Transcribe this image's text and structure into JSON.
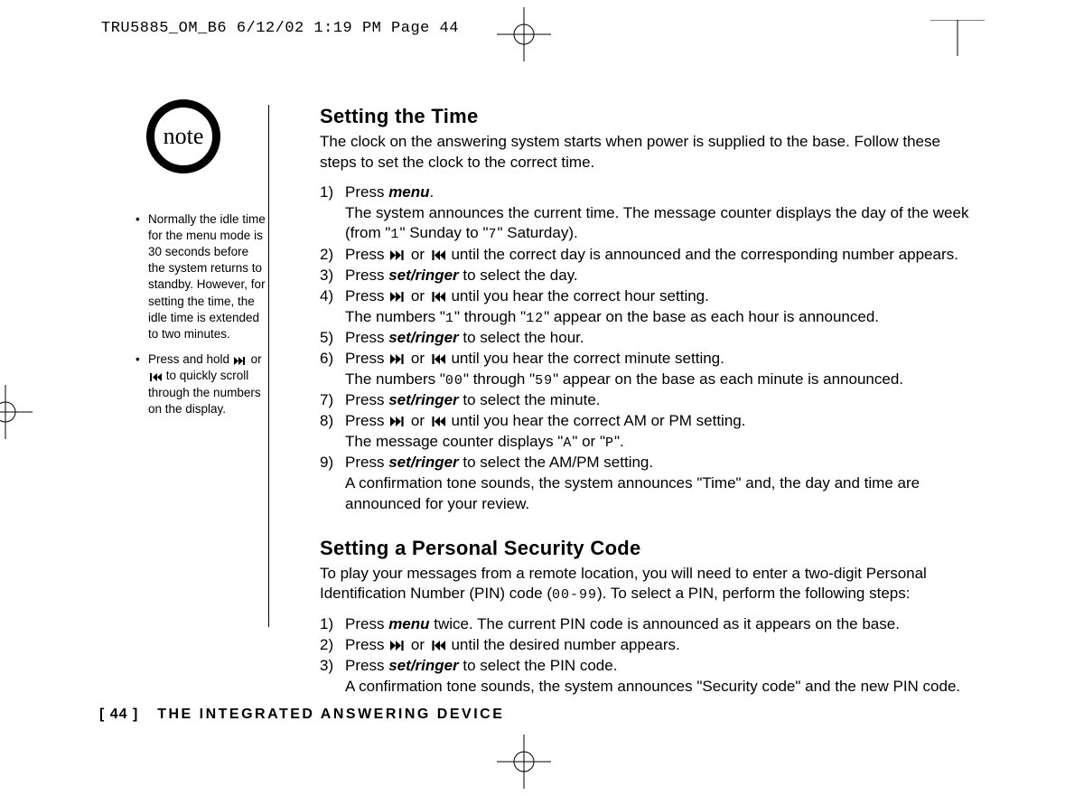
{
  "printHeader": "TRU5885_OM_B6  6/12/02  1:19 PM  Page 44",
  "noteLabel": "note",
  "sideNotes": [
    "Normally the idle time for the menu mode is 30 seconds before the system returns to standby. However, for setting the time, the idle time is extended to two minutes.",
    "Press and hold ⏭ or ⏮ to quickly scroll through the numbers on the display."
  ],
  "section1": {
    "title": "Setting the Time",
    "intro": "The clock on the answering system starts when power is supplied to the base. Follow these steps to set the clock to the correct time.",
    "steps": [
      {
        "n": "1)",
        "a": "Press ",
        "cmd": "menu",
        "b": ".",
        "c": "The system announces the current time. The message counter displays the day of the week (from \"",
        "seg1": "1",
        "d": "\" Sunday to \"",
        "seg2": "7",
        "e": "\" Saturday)."
      },
      {
        "n": "2)",
        "a": "Press ⏭ or ⏮ until the correct day is announced and the corresponding number appears."
      },
      {
        "n": "3)",
        "a": "Press ",
        "cmd": "set/ringer",
        "b": " to select the day."
      },
      {
        "n": "4)",
        "a": "Press ⏭ or ⏮ until you hear the correct hour setting.",
        "c": "The numbers \"",
        "seg1": "1",
        "d": "\" through \"",
        "seg2": "12",
        "e": "\" appear on the base as each hour is announced."
      },
      {
        "n": "5)",
        "a": "Press ",
        "cmd": "set/ringer",
        "b": " to select the hour."
      },
      {
        "n": "6)",
        "a": "Press ⏭ or ⏮ until you hear the correct minute setting.",
        "c": "The numbers \"",
        "seg1": "00",
        "d": "\" through \"",
        "seg2": "59",
        "e": "\" appear on the base as each minute is announced."
      },
      {
        "n": "7)",
        "a": "Press ",
        "cmd": "set/ringer",
        "b": " to select the minute."
      },
      {
        "n": "8)",
        "a": "Press ⏭ or ⏮ until you hear the correct AM or PM setting.",
        "c": "The message counter displays \"",
        "seg1": "A",
        "d": "\" or \"",
        "seg2": "P",
        "e": "\"."
      },
      {
        "n": "9)",
        "a": "Press ",
        "cmd": "set/ringer",
        "b": " to select the AM/PM setting.",
        "c": "A confirmation tone sounds, the system announces \"Time\" and, the day and time are announced for your review."
      }
    ]
  },
  "section2": {
    "title": "Setting a Personal Security Code",
    "introA": "To play your messages from a remote location, you will need to enter a two-digit Personal Identification Number (PIN) code (",
    "seg": "00-99",
    "introB": "). To select a PIN, perform the following steps:",
    "steps": [
      {
        "n": "1)",
        "a": "Press ",
        "cmd": "menu",
        "b": " twice. The current PIN code is announced as it appears on the base."
      },
      {
        "n": "2)",
        "a": "Press ⏭ or ⏮ until the desired number appears."
      },
      {
        "n": "3)",
        "a": "Press ",
        "cmd": "set/ringer",
        "b": " to select the PIN code.",
        "c": "A confirmation tone sounds, the system announces \"Security code\" and the new PIN code."
      }
    ]
  },
  "footer": {
    "page": "[ 44 ]",
    "title": "THE INTEGRATED ANSWERING DEVICE"
  }
}
